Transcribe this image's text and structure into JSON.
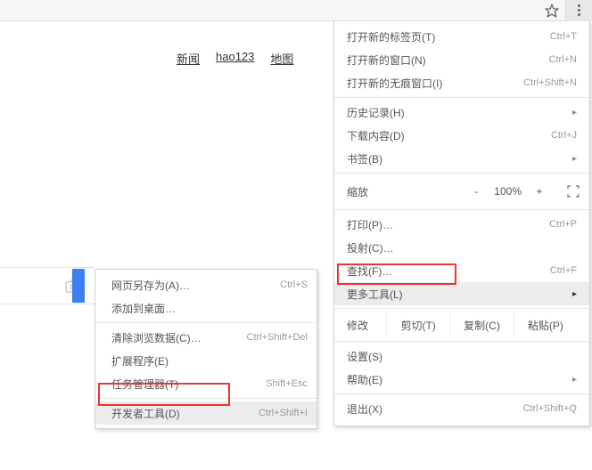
{
  "toolbar": {
    "star": "star-icon",
    "kebab": "menu-icon"
  },
  "page": {
    "links": [
      "新闻",
      "hao123",
      "地图"
    ],
    "camera": "camera-icon"
  },
  "submenu": {
    "items": [
      {
        "label": "网页另存为(A)…",
        "shortcut": "Ctrl+S"
      },
      {
        "label": "添加到桌面…",
        "shortcut": ""
      }
    ],
    "group2": [
      {
        "label": "清除浏览数据(C)…",
        "shortcut": "Ctrl+Shift+Del"
      },
      {
        "label": "扩展程序(E)",
        "shortcut": ""
      },
      {
        "label": "任务管理器(T)",
        "shortcut": "Shift+Esc"
      }
    ],
    "group3": [
      {
        "label": "开发者工具(D)",
        "shortcut": "Ctrl+Shift+I"
      }
    ]
  },
  "mainmenu": {
    "g1": [
      {
        "label": "打开新的标签页(T)",
        "shortcut": "Ctrl+T"
      },
      {
        "label": "打开新的窗口(N)",
        "shortcut": "Ctrl+N"
      },
      {
        "label": "打开新的无痕窗口(I)",
        "shortcut": "Ctrl+Shift+N"
      }
    ],
    "g2": [
      {
        "label": "历史记录(H)",
        "shortcut": "",
        "arrow": true
      },
      {
        "label": "下载内容(D)",
        "shortcut": "Ctrl+J"
      },
      {
        "label": "书签(B)",
        "shortcut": "",
        "arrow": true
      }
    ],
    "zoom": {
      "label": "缩放",
      "minus": "-",
      "value": "100%",
      "plus": "+"
    },
    "g3": [
      {
        "label": "打印(P)…",
        "shortcut": "Ctrl+P"
      },
      {
        "label": "投射(C)…",
        "shortcut": ""
      },
      {
        "label": "查找(F)…",
        "shortcut": "Ctrl+F"
      },
      {
        "label": "更多工具(L)",
        "shortcut": "",
        "arrow": true,
        "hover": true
      }
    ],
    "edit": {
      "label": "修改",
      "cut": "剪切(T)",
      "copy": "复制(C)",
      "paste": "粘贴(P)"
    },
    "g4": [
      {
        "label": "设置(S)",
        "shortcut": ""
      },
      {
        "label": "帮助(E)",
        "shortcut": "",
        "arrow": true
      }
    ],
    "g5": [
      {
        "label": "退出(X)",
        "shortcut": "Ctrl+Shift+Q"
      }
    ]
  }
}
